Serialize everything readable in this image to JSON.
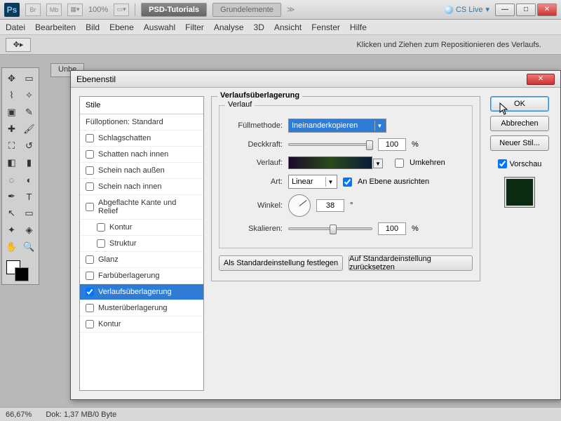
{
  "app": {
    "ps": "Ps",
    "br": "Br",
    "mb": "Mb",
    "zoom": "100%",
    "tab_active": "PSD-Tutorials",
    "tab_other": "Grundelemente",
    "cslive": "CS Live"
  },
  "menu": [
    "Datei",
    "Bearbeiten",
    "Bild",
    "Ebene",
    "Auswahl",
    "Filter",
    "Analyse",
    "3D",
    "Ansicht",
    "Fenster",
    "Hilfe"
  ],
  "options_hint": "Klicken und Ziehen zum Repositionieren des Verlaufs.",
  "doc_tab": "Unbe",
  "status": {
    "zoom": "66,67%",
    "doc": "Dok: 1,37 MB/0 Byte"
  },
  "dialog": {
    "title": "Ebenenstil",
    "styles_header": "Stile",
    "fill_options": "Fülloptionen: Standard",
    "styles": [
      {
        "label": "Schlagschatten",
        "checked": false
      },
      {
        "label": "Schatten nach innen",
        "checked": false
      },
      {
        "label": "Schein nach außen",
        "checked": false
      },
      {
        "label": "Schein nach innen",
        "checked": false
      },
      {
        "label": "Abgeflachte Kante und Relief",
        "checked": false
      },
      {
        "label": "Kontur",
        "checked": false,
        "sub": true
      },
      {
        "label": "Struktur",
        "checked": false,
        "sub": true
      },
      {
        "label": "Glanz",
        "checked": false
      },
      {
        "label": "Farbüberlagerung",
        "checked": false
      },
      {
        "label": "Verlaufsüberlagerung",
        "checked": true,
        "selected": true
      },
      {
        "label": "Musterüberlagerung",
        "checked": false
      },
      {
        "label": "Kontur",
        "checked": false
      }
    ],
    "group_title": "Verlaufsüberlagerung",
    "inner_title": "Verlauf",
    "labels": {
      "blend": "Füllmethode:",
      "blend_value": "Ineinanderkopieren",
      "opacity": "Deckkraft:",
      "opacity_value": "100",
      "pct": "%",
      "gradient": "Verlauf:",
      "reverse": "Umkehren",
      "style": "Art:",
      "style_value": "Linear",
      "align": "An Ebene ausrichten",
      "angle": "Winkel:",
      "angle_value": "38",
      "deg": "°",
      "scale": "Skalieren:",
      "scale_value": "100"
    },
    "btn_default": "Als Standardeinstellung festlegen",
    "btn_reset": "Auf Standardeinstellung zurücksetzen",
    "ok": "OK",
    "cancel": "Abbrechen",
    "newstyle": "Neuer Stil...",
    "preview": "Vorschau"
  }
}
